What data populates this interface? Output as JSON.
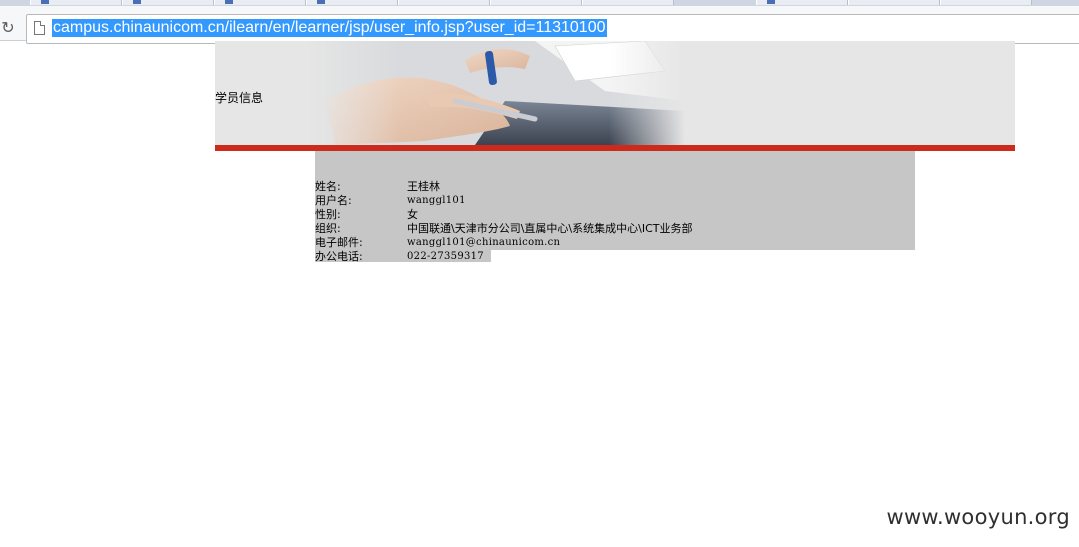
{
  "browser": {
    "url": "campus.chinaunicom.cn/ilearn/en/learner/jsp/user_info.jsp?user_id=11310100",
    "reload_icon": "reload-icon",
    "page_icon": "page-icon"
  },
  "banner": {
    "title": "学员信息"
  },
  "user_info": {
    "name_label": "姓名:",
    "name_value": "王桂林",
    "username_label": "用户名:",
    "username_value": "wanggl101",
    "gender_label": "性别:",
    "gender_value": "女",
    "org_label": "组织:",
    "org_value": "中国联通\\天津市分公司\\直属中心\\系统集成中心\\ICT业务部",
    "email_label": "电子邮件:",
    "email_value": "wanggl101@chinaunicom.cn",
    "phone_label": "办公电话:",
    "phone_value": "022-27359317"
  },
  "watermark": "www.wooyun.org",
  "colors": {
    "accent_bar": "#cc2a1a",
    "info_bg": "#c6c6c6",
    "url_highlight": "#3399ff"
  }
}
